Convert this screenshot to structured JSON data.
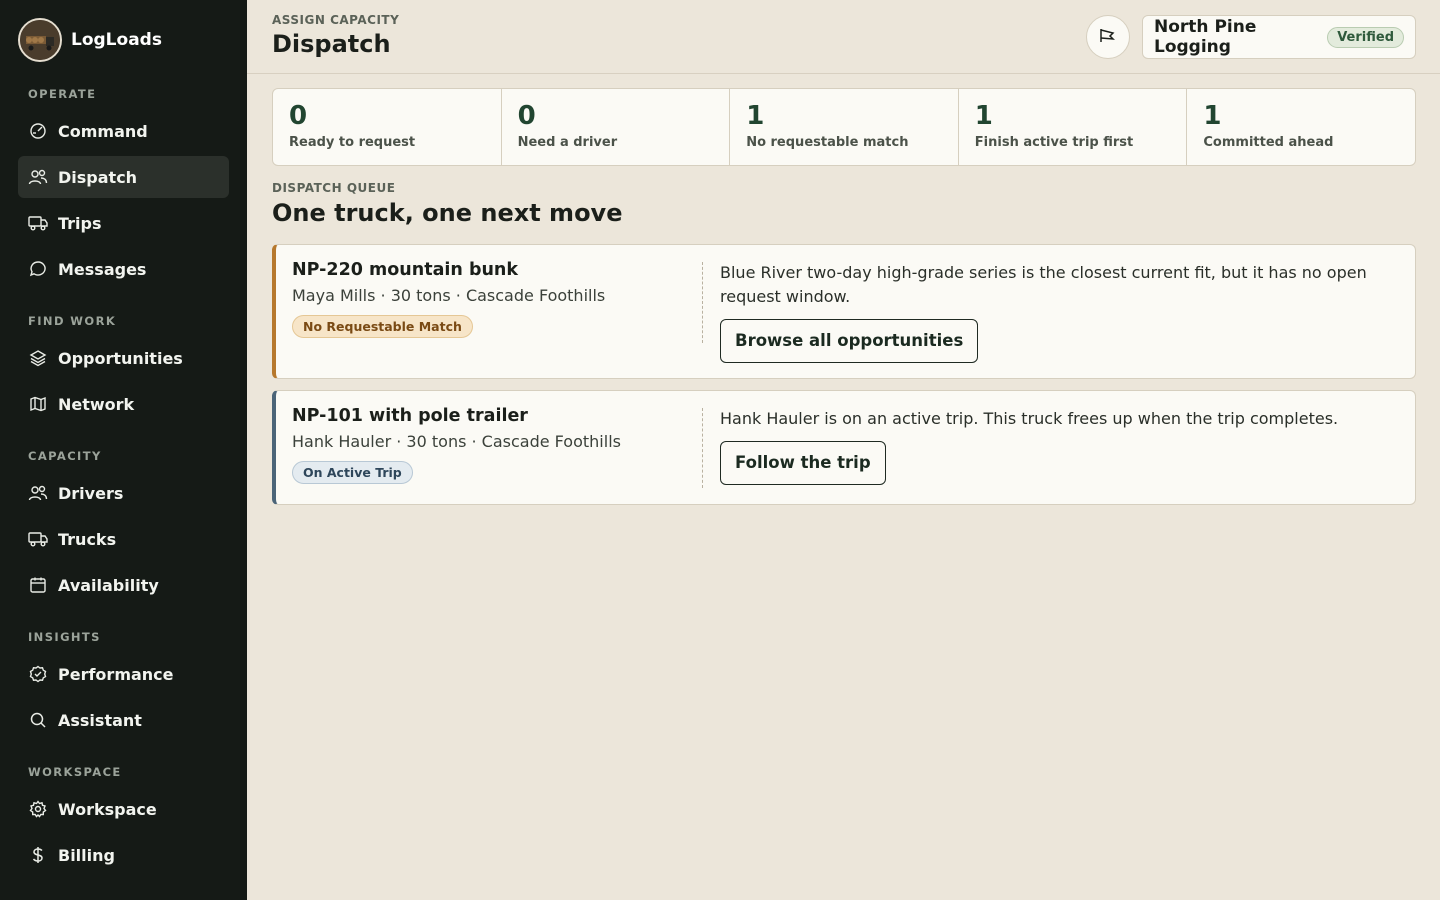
{
  "brand": {
    "name": "LogLoads",
    "logo_icon": "log-truck-logo"
  },
  "sidebar": {
    "sections": [
      {
        "label": "OPERATE",
        "items": [
          {
            "label": "Command",
            "icon": "gauge-icon"
          },
          {
            "label": "Dispatch",
            "icon": "people-icon",
            "active": true
          },
          {
            "label": "Trips",
            "icon": "truck-icon"
          },
          {
            "label": "Messages",
            "icon": "chat-bubble-icon"
          }
        ]
      },
      {
        "label": "FIND WORK",
        "items": [
          {
            "label": "Opportunities",
            "icon": "layers-icon"
          },
          {
            "label": "Network",
            "icon": "map-icon"
          }
        ]
      },
      {
        "label": "CAPACITY",
        "items": [
          {
            "label": "Drivers",
            "icon": "people-icon"
          },
          {
            "label": "Trucks",
            "icon": "truck-icon"
          },
          {
            "label": "Availability",
            "icon": "calendar-icon"
          }
        ]
      },
      {
        "label": "INSIGHTS",
        "items": [
          {
            "label": "Performance",
            "icon": "badge-check-icon"
          },
          {
            "label": "Assistant",
            "icon": "search-icon"
          }
        ]
      },
      {
        "label": "WORKSPACE",
        "items": [
          {
            "label": "Workspace",
            "icon": "gear-icon"
          },
          {
            "label": "Billing",
            "icon": "dollar-icon"
          }
        ]
      }
    ]
  },
  "header": {
    "eyebrow": "ASSIGN CAPACITY",
    "title": "Dispatch",
    "announce_icon": "megaphone-icon",
    "org_name": "North Pine Logging",
    "org_badge": "Verified"
  },
  "stats": [
    {
      "value": "0",
      "label": "Ready to request"
    },
    {
      "value": "0",
      "label": "Need a driver"
    },
    {
      "value": "1",
      "label": "No requestable match"
    },
    {
      "value": "1",
      "label": "Finish active trip first"
    },
    {
      "value": "1",
      "label": "Committed ahead"
    }
  ],
  "queue": {
    "eyebrow": "DISPATCH QUEUE",
    "title": "One truck, one next move",
    "cards": [
      {
        "title": "NP-220 mountain bunk",
        "meta": "Maya Mills · 30 tons · Cascade Foothills",
        "badge": "No Requestable Match",
        "note": "Blue River two-day high-grade series is the closest current fit, but it has no open request window.",
        "action": "Browse all opportunities",
        "accent": "#b6782d"
      },
      {
        "title": "NP-101 with pole trailer",
        "meta": "Hank Hauler · 30 tons · Cascade Foothills",
        "badge": "On Active Trip",
        "note": "Hank Hauler is on an active trip. This truck frees up when the trip completes.",
        "action": "Follow the trip",
        "accent": "#4b6478"
      }
    ]
  },
  "colors": {
    "sidebar_bg": "#151a16",
    "page_bg": "#ece6da",
    "accent_green": "#214530",
    "amber": "#b6782d",
    "slate": "#4b6478"
  }
}
